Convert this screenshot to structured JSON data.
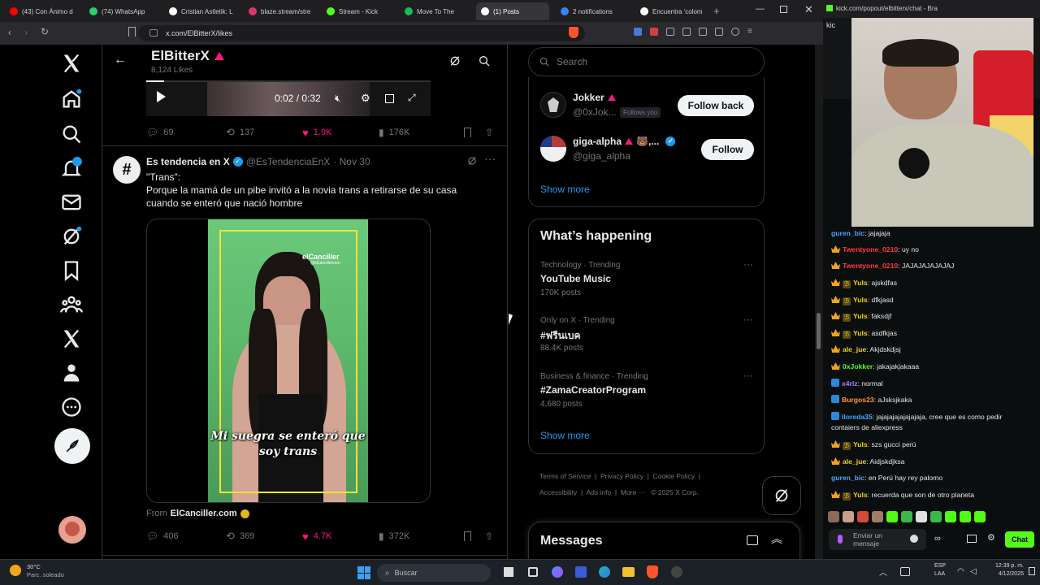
{
  "browser": {
    "tabs": [
      {
        "label": "(43) Con Ánimo d",
        "color": "#ff0000"
      },
      {
        "label": "(74) WhatsApp",
        "color": "#25d366"
      },
      {
        "label": "Cristian Astletik: L",
        "color": "#ffffff"
      },
      {
        "label": "blaze.stream/stre",
        "color": "#e0356a"
      },
      {
        "label": "Stream - Kick",
        "color": "#53fc18"
      },
      {
        "label": "Move To The",
        "color": "#1db954"
      },
      {
        "label": "(1) Posts",
        "color": "#ffffff"
      },
      {
        "label": "2 notifications",
        "color": "#3b82f6"
      },
      {
        "label": "Encuentra 'colom",
        "color": "#ffffff"
      }
    ],
    "url": "x.com/ElBitterX/likes"
  },
  "header": {
    "title": "ElBitterX",
    "subtitle": "8,124 Likes"
  },
  "video_top": {
    "time": "0:02 / 0:32"
  },
  "post1_stats": {
    "replies": "69",
    "reposts": "137",
    "likes": "1.9K",
    "views": "176K"
  },
  "post2": {
    "author": "Es tendencia en X",
    "handle": "@EsTendenciaEnX",
    "date": "· Nov 30",
    "line1": "\"Trans\":",
    "line2": "Porque la mamá de un pibe invitó a la novia trans a retirarse de su casa cuando se enteró que nació hombre",
    "caption": "Mi suegra se enteró que soy trans",
    "watermark": "elCanciller",
    "watermark_sub": "@elcancillercom",
    "from_label": "From",
    "from_source": "ElCanciller.com",
    "stats": {
      "replies": "406",
      "reposts": "369",
      "likes": "4.7K",
      "views": "372K"
    }
  },
  "sidebar": {
    "search_placeholder": "Search",
    "follow": [
      {
        "name": "Jokker",
        "handle": "@0xJok...",
        "note": "Follows you",
        "button": "Follow back"
      },
      {
        "name": "giga-alpha",
        "emoji": "🐻,...",
        "handle": "@giga_alpha",
        "button": "Follow"
      }
    ],
    "show_more_1": "Show more",
    "happening_title": "What’s happening",
    "trends": [
      {
        "context": "Technology · Trending",
        "name": "YouTube Music",
        "posts": "170K posts"
      },
      {
        "context": "Only on X · Trending",
        "name": "#ฟรีนเบค",
        "posts": "88.4K posts"
      },
      {
        "context": "Business & finance · Trending",
        "name": "#ZamaCreatorProgram",
        "posts": "4,680 posts"
      }
    ],
    "show_more_2": "Show more",
    "footer": [
      "Terms of Service",
      "Privacy Policy",
      "Cookie Policy",
      "Accessibility",
      "Ads info",
      "More ···",
      "© 2025 X Corp."
    ],
    "messages": "Messages"
  },
  "kick": {
    "url": "kick.com/popout/elbitterx/chat - Bra",
    "messages": [
      {
        "user": "guren_bic",
        "color": "#4ea2ff",
        "text": "jajajaja",
        "badges": ""
      },
      {
        "user": "Twentyone_0210",
        "color": "#ff3b3b",
        "text": "uy no",
        "badges": "c"
      },
      {
        "user": "Twentyone_0210",
        "color": "#ff3b3b",
        "text": "JAJAJAJAJAJAJ",
        "badges": "c"
      },
      {
        "user": "Yuls",
        "color": "#f2d21b",
        "text": "ajskdfas",
        "badges": "cs"
      },
      {
        "user": "Yuls",
        "color": "#f2d21b",
        "text": "dfkjasd",
        "badges": "cs"
      },
      {
        "user": "Yuls",
        "color": "#f2d21b",
        "text": "faksdjf",
        "badges": "cs"
      },
      {
        "user": "Yuls",
        "color": "#f2d21b",
        "text": "asdfkjas",
        "badges": "cs"
      },
      {
        "user": "ale_jue",
        "color": "#f2d21b",
        "text": "Akjdskdjsj",
        "badges": "c"
      },
      {
        "user": "0xJokker",
        "color": "#53fc18",
        "text": "jakajakjakaaa",
        "badges": "c"
      },
      {
        "user": "x4rlz",
        "color": "#b67cff",
        "text": "normal",
        "badges": "m"
      },
      {
        "user": "Burgos23",
        "color": "#ff9a3b",
        "text": "aJsksjkaka",
        "badges": "m"
      },
      {
        "user": "lloreda35",
        "color": "#4ea2ff",
        "text": "jajajajajajajajaja, cree que es como pedir contaiers de aliexpress",
        "badges": "m"
      },
      {
        "user": "Yuls",
        "color": "#f2d21b",
        "text": "szs gucci perú",
        "badges": "cs"
      },
      {
        "user": "ale_jue",
        "color": "#f2d21b",
        "text": "Aidjskdjksa",
        "badges": "c"
      },
      {
        "user": "guren_bic",
        "color": "#4ea2ff",
        "text": "en Perú hay rey palomo",
        "badges": ""
      },
      {
        "user": "Yuls",
        "color": "#f2d21b",
        "text": "recuerda que son de otro planeta",
        "badges": "cs"
      }
    ],
    "input_placeholder": "Enviar un mensaje",
    "chat_button": "Chat"
  },
  "taskbar": {
    "weather_temp": "30°C",
    "weather_desc": "Parc. soleado",
    "search": "Buscar",
    "lang": "ESP",
    "lang2": "LAA",
    "time": "12:39 p. m.",
    "date": "4/12/2025"
  }
}
